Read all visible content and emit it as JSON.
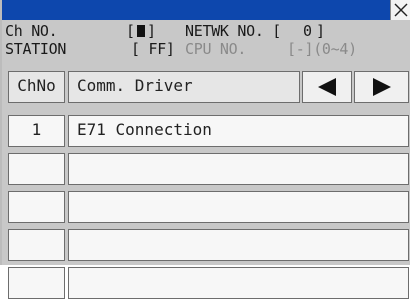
{
  "window": {
    "close_icon": "close-x-icon"
  },
  "info": {
    "ch_no_label": "Ch NO.",
    "ch_no_value_prefix": "[",
    "ch_no_value_suffix": "]",
    "netwk_label": "NETWK NO. [",
    "netwk_value": "0",
    "netwk_suffix": "]",
    "station_label": "STATION",
    "station_value": "[ FF]",
    "cpu_label": "CPU NO.",
    "cpu_value": "[-](0~4)"
  },
  "table": {
    "header_chno": "ChNo",
    "header_driver": "Comm. Driver",
    "prev_icon": "triangle-left-icon",
    "next_icon": "triangle-right-icon",
    "rows": [
      {
        "chno": "1",
        "driver": "E71 Connection"
      },
      {
        "chno": "",
        "driver": ""
      },
      {
        "chno": "",
        "driver": ""
      },
      {
        "chno": "",
        "driver": ""
      },
      {
        "chno": "",
        "driver": ""
      }
    ]
  },
  "colors": {
    "titlebar": "#0d47ad",
    "background": "#c8c8c8",
    "cell": "#f7f7f7"
  }
}
